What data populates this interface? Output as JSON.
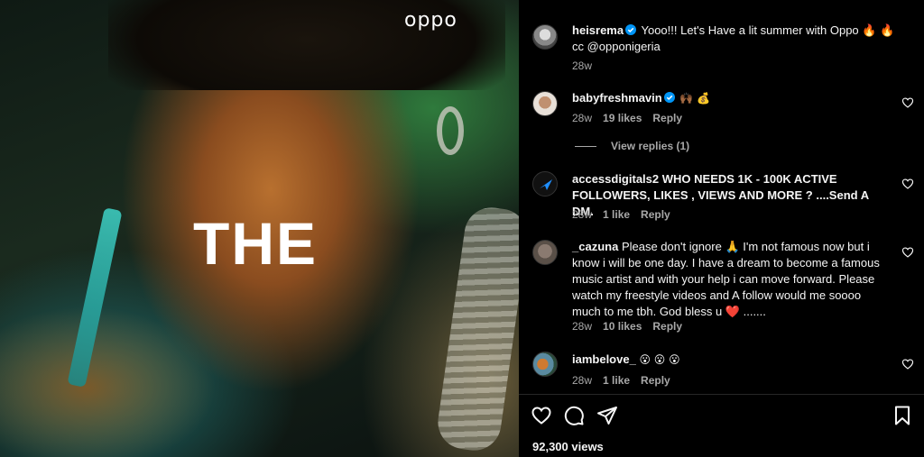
{
  "media": {
    "brand_text": "oppo",
    "overlay_text": "THE"
  },
  "caption": {
    "username": "heisrema",
    "text": "Yooo!!! Let's Have a lit summer with Oppo 🔥 🔥 cc @opponigeria",
    "time": "28w"
  },
  "comments": [
    {
      "username": "babyfreshmavin",
      "verified": true,
      "text": "🙌🏾 💰",
      "time": "28w",
      "likes": "19 likes",
      "reply": "Reply"
    },
    {
      "username": "accessdigitals2",
      "verified": false,
      "text": "WHO NEEDS 1K - 100K ACTIVE FOLLOWERS, LIKES , VIEWS AND MORE ? ....Send A DM.",
      "time": "28w",
      "likes": "1 like",
      "reply": "Reply"
    },
    {
      "username": "_cazuna",
      "verified": false,
      "text": "Please don't ignore 🙏 I'm not famous now but i know i will be one day. I have a dream to become a famous music artist and with your help i can move forward. Please watch my freestyle videos and A follow would me soooo much to me tbh. God bless u ❤️ .......",
      "time": "28w",
      "likes": "10 likes",
      "reply": "Reply"
    },
    {
      "username": "iambelove_",
      "verified": false,
      "text": "😮 😮 😮",
      "time": "28w",
      "likes": "1 like",
      "reply": "Reply"
    }
  ],
  "view_replies": "View replies (1)",
  "stats": {
    "views": "92,300 views"
  },
  "icons": {
    "like": "heart-icon",
    "comment": "comment-icon",
    "share": "share-icon",
    "save": "bookmark-icon"
  },
  "colors": {
    "background": "#000000",
    "text": "#f5f5f5",
    "muted": "#a8a8a8",
    "verified": "#0095f6",
    "accent_red": "#ff3040"
  }
}
